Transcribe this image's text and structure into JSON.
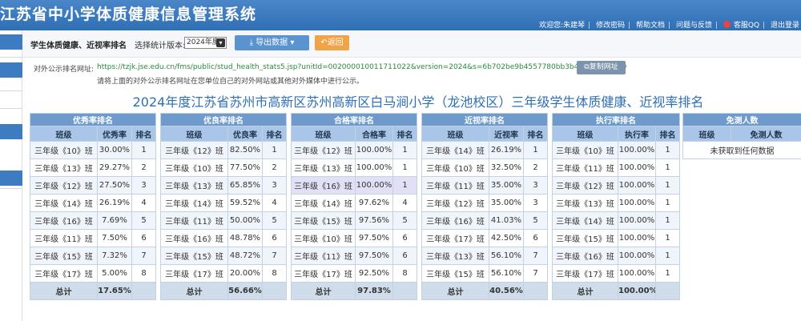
{
  "app": {
    "title": "江苏省中小学体质健康信息管理系统"
  },
  "userbar": {
    "welcome": "欢迎您:朱建琴",
    "links": [
      "修改密码",
      "帮助文档",
      "问题与反馈",
      "客服QQ",
      "退出登录"
    ]
  },
  "toolbar": {
    "heading": "学生体质健康、近视率排名",
    "version_label": "选择统计版本:",
    "version_value": "2024年度",
    "export_label": "导出数据",
    "back_label": "返回"
  },
  "url": {
    "label": "对外公示排名网址:",
    "value": "https://tzjk.jse.edu.cn/fms/public/stud_health_stats5.jsp?unitId=002000010011711022&version=2024&s=6b702be9b4557780bb3b4d24ea2bdf90",
    "copy_label": "复制网址",
    "hint": "请将上面的对外公示排名网址在您单位自己的对外网站或其他对外媒体中进行公示。"
  },
  "report_title": "2024年度江苏省苏州市高新区苏州高新区白马涧小学（龙池校区）三年级学生体质健康、近视率排名",
  "colors": {
    "header_blue": "#6e9bcc",
    "subheader_blue": "#a9c6e8",
    "title_blue": "#2f6fb5",
    "export_button": "#5a93d0",
    "back_button": "#f0a347"
  },
  "tables": [
    {
      "caption": "优秀率排名",
      "headers": [
        "班级",
        "优秀率",
        "排名"
      ],
      "rows": [
        [
          "三年级《10》班",
          "30.00%",
          "1"
        ],
        [
          "三年级《13》班",
          "29.27%",
          "2"
        ],
        [
          "三年级《12》班",
          "27.50%",
          "3"
        ],
        [
          "三年级《14》班",
          "26.19%",
          "4"
        ],
        [
          "三年级《16》班",
          "7.69%",
          "5"
        ],
        [
          "三年级《11》班",
          "7.50%",
          "6"
        ],
        [
          "三年级《15》班",
          "7.32%",
          "7"
        ],
        [
          "三年级《17》班",
          "5.00%",
          "8"
        ]
      ],
      "footer": [
        "总计",
        "17.65%",
        ""
      ]
    },
    {
      "caption": "优良率排名",
      "headers": [
        "班级",
        "优良率",
        "排名"
      ],
      "rows": [
        [
          "三年级《12》班",
          "82.50%",
          "1"
        ],
        [
          "三年级《10》班",
          "77.50%",
          "2"
        ],
        [
          "三年级《13》班",
          "65.85%",
          "3"
        ],
        [
          "三年级《14》班",
          "59.52%",
          "4"
        ],
        [
          "三年级《11》班",
          "50.00%",
          "5"
        ],
        [
          "三年级《16》班",
          "48.78%",
          "6"
        ],
        [
          "三年级《15》班",
          "48.72%",
          "7"
        ],
        [
          "三年级《17》班",
          "20.00%",
          "8"
        ]
      ],
      "footer": [
        "总计",
        "56.66%",
        ""
      ]
    },
    {
      "caption": "合格率排名",
      "headers": [
        "班级",
        "合格率",
        "排名"
      ],
      "rows": [
        [
          "三年级《12》班",
          "100.00%",
          "1"
        ],
        [
          "三年级《13》班",
          "100.00%",
          "1"
        ],
        [
          "三年级《16》班",
          "100.00%",
          "1"
        ],
        [
          "三年级《14》班",
          "97.62%",
          "4"
        ],
        [
          "三年级《15》班",
          "97.56%",
          "5"
        ],
        [
          "三年级《10》班",
          "97.50%",
          "6"
        ],
        [
          "三年级《11》班",
          "97.50%",
          "6"
        ],
        [
          "三年级《17》班",
          "92.50%",
          "8"
        ]
      ],
      "footer": [
        "总计",
        "97.83%",
        ""
      ]
    },
    {
      "caption": "近视率排名",
      "headers": [
        "班级",
        "近视率",
        "排名"
      ],
      "rows": [
        [
          "三年级《14》班",
          "26.19%",
          "1"
        ],
        [
          "三年级《10》班",
          "32.50%",
          "2"
        ],
        [
          "三年级《11》班",
          "35.00%",
          "3"
        ],
        [
          "三年级《12》班",
          "35.00%",
          "3"
        ],
        [
          "三年级《16》班",
          "41.03%",
          "5"
        ],
        [
          "三年级《17》班",
          "42.50%",
          "6"
        ],
        [
          "三年级《13》班",
          "56.10%",
          "7"
        ],
        [
          "三年级《15》班",
          "56.10%",
          "7"
        ]
      ],
      "footer": [
        "总计",
        "40.56%",
        ""
      ]
    },
    {
      "caption": "执行率排名",
      "headers": [
        "班级",
        "执行率",
        "排名"
      ],
      "rows": [
        [
          "三年级《10》班",
          "100.00%",
          "1"
        ],
        [
          "三年级《11》班",
          "100.00%",
          "1"
        ],
        [
          "三年级《12》班",
          "100.00%",
          "1"
        ],
        [
          "三年级《13》班",
          "100.00%",
          "1"
        ],
        [
          "三年级《14》班",
          "100.00%",
          "1"
        ],
        [
          "三年级《15》班",
          "100.00%",
          "1"
        ],
        [
          "三年级《16》班",
          "100.00%",
          "1"
        ],
        [
          "三年级《17》班",
          "100.00%",
          "1"
        ]
      ],
      "footer": [
        "总计",
        "100.00%",
        ""
      ]
    },
    {
      "caption": "免测人数",
      "headers": [
        "班级",
        "免测人数"
      ],
      "rows": [],
      "empty_text": "未获取到任何数据",
      "footer": null
    }
  ]
}
